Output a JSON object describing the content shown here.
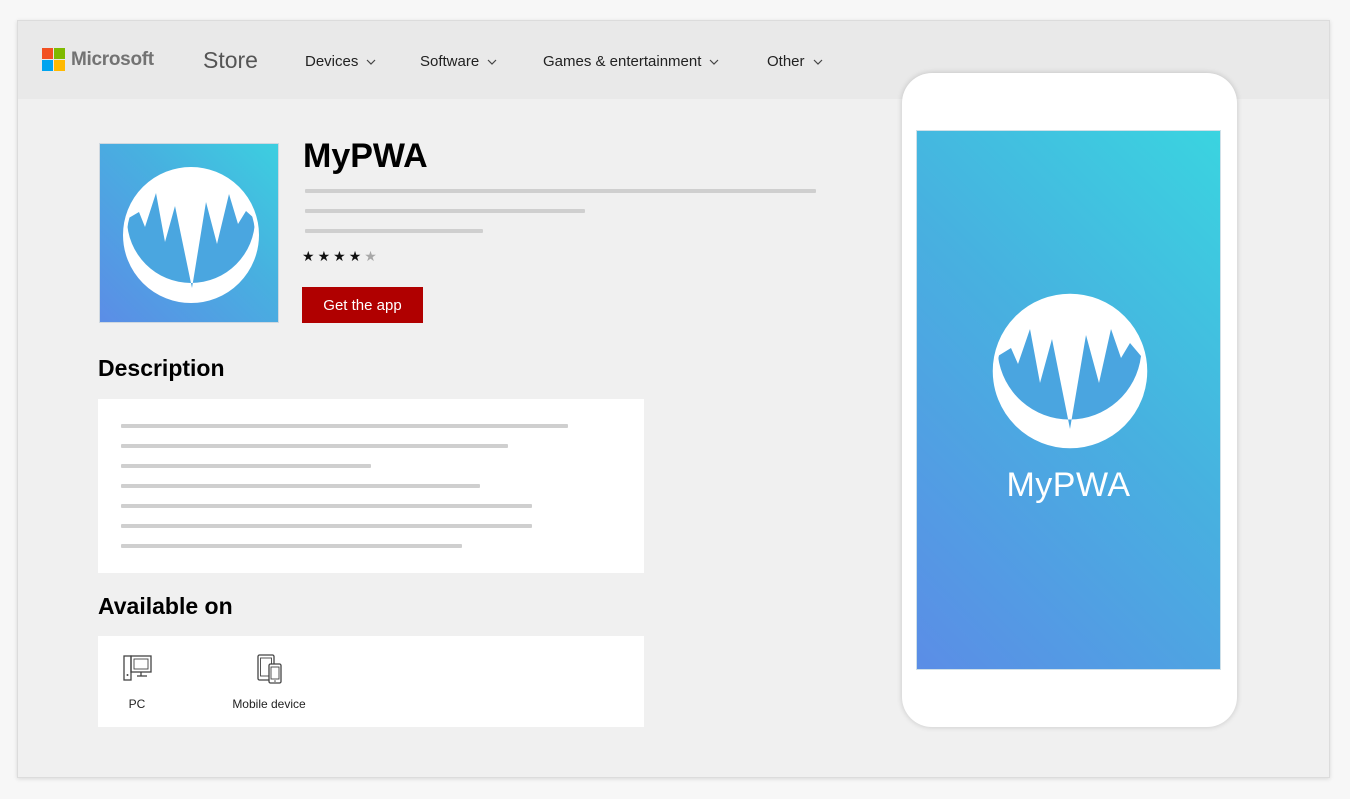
{
  "brand": {
    "name": "Microsoft",
    "section": "Store"
  },
  "nav": {
    "items": [
      {
        "label": "Devices"
      },
      {
        "label": "Software"
      },
      {
        "label": "Games & entertainment"
      },
      {
        "label": "Other"
      }
    ]
  },
  "app": {
    "title": "MyPWA",
    "rating": {
      "value": 4,
      "max": 5
    },
    "cta_label": "Get the app"
  },
  "description": {
    "heading": "Description"
  },
  "available_on": {
    "heading": "Available on",
    "devices": [
      {
        "label": "PC",
        "icon": "pc-icon"
      },
      {
        "label": "Mobile device",
        "icon": "mobile-device-icon"
      }
    ]
  },
  "splash": {
    "app_name": "MyPWA"
  },
  "colors": {
    "cta": "#b00000",
    "gradient_start": "#5b8de6",
    "gradient_end": "#3ccfe0",
    "placeholder_line": "#cfcfcf"
  }
}
